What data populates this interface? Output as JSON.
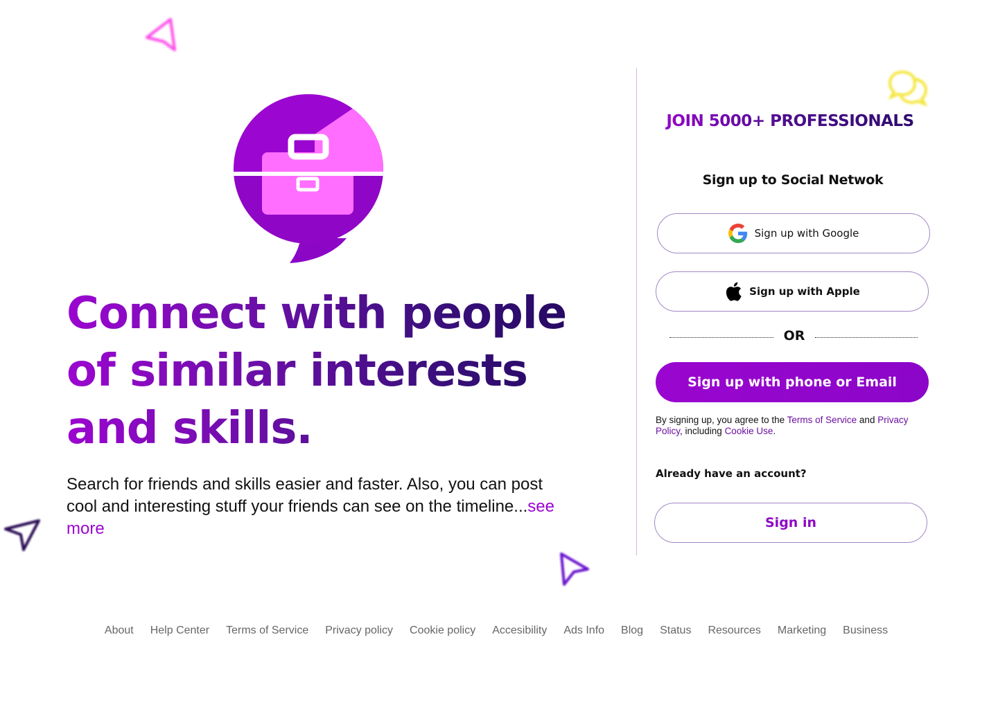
{
  "hero": {
    "headline": "Connect with people of similar interests and skills.",
    "tagline": "Search for friends and skills easier and faster. Also, you can post cool and interesting stuff your friends can see on the timeline...",
    "see_more": "see more"
  },
  "signup": {
    "join_title": "JOIN 5000+ PROFESSIONALS",
    "heading": "Sign up to Social Netwok",
    "google_label": "Sign up with Google",
    "apple_label": "Sign up with Apple",
    "or_label": "OR",
    "phone_email_label": "Sign up with phone or Email",
    "legal": {
      "prefix": "By signing up, you agree to the ",
      "terms": "Terms of Service",
      "and": " and ",
      "privacy": "Privacy Policy",
      "including": ", including ",
      "cookie": "Cookie Use",
      "end": "."
    },
    "already": "Already have an account?",
    "signin_label": "Sign in"
  },
  "footer": {
    "links": [
      "About",
      "Help Center",
      "Terms of Service",
      "Privacy policy",
      "Cookie policy",
      "Accesibility",
      "Ads Info",
      "Blog",
      "Status",
      "Resources",
      "Marketing",
      "Business"
    ]
  },
  "colors": {
    "brand_purple": "#9b06d0",
    "brand_pink": "#ff6eff",
    "deep_indigo": "#22085e",
    "chat_yellow": "#f5e63a"
  },
  "icons": {
    "logo": "briefcase-chat-bubble-logo",
    "google": "google-g-icon",
    "apple": "apple-icon",
    "deco": [
      "pink-arrow-icon",
      "yellow-chat-icon",
      "dark-arrow-icon",
      "purple-cursor-icon"
    ]
  }
}
